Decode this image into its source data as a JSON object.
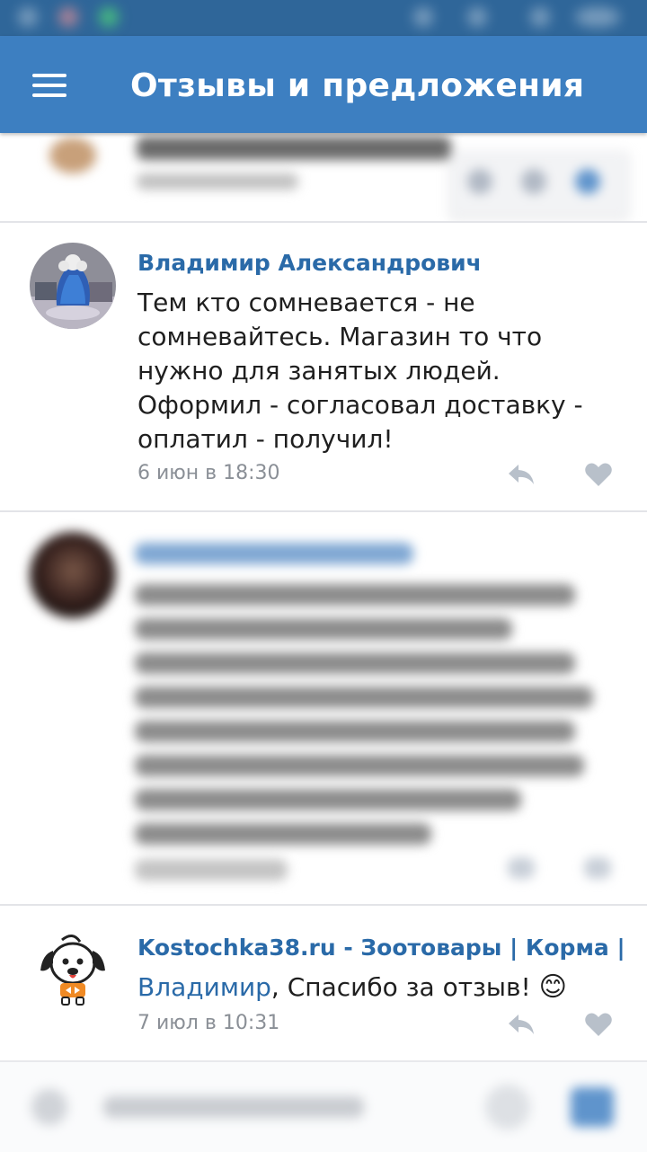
{
  "app": {
    "title": "Отзывы и предложения",
    "accent_color": "#3d7fc1",
    "status_bar_color": "#2f6699"
  },
  "comments": [
    {
      "author": "Владимир Александрович",
      "text": "Тем кто сомневается - не сомневайтесь. Магазин то что нужно для занятых людей. Оформил - согласовал доставку - оплатил - получил!",
      "date": "6 июн в 18:30",
      "avatar": "avatar-photo",
      "actions": [
        "reply-icon",
        "like-icon"
      ]
    },
    {
      "author": "Kostochka38.ru - Зоотовары | Корма |",
      "reply_to": "Владимир",
      "text": ", Спасибо за отзыв!",
      "emoji": "😊",
      "date": "7 июл в 10:31",
      "avatar": "dog-logo-avatar",
      "actions": [
        "reply-icon",
        "like-icon"
      ]
    }
  ],
  "icons": {
    "menu": "hamburger-menu-icon",
    "reply": "reply-icon",
    "like": "heart-icon",
    "attach": "paperclip-icon",
    "sticker": "sticker-icon",
    "send": "send-icon"
  }
}
